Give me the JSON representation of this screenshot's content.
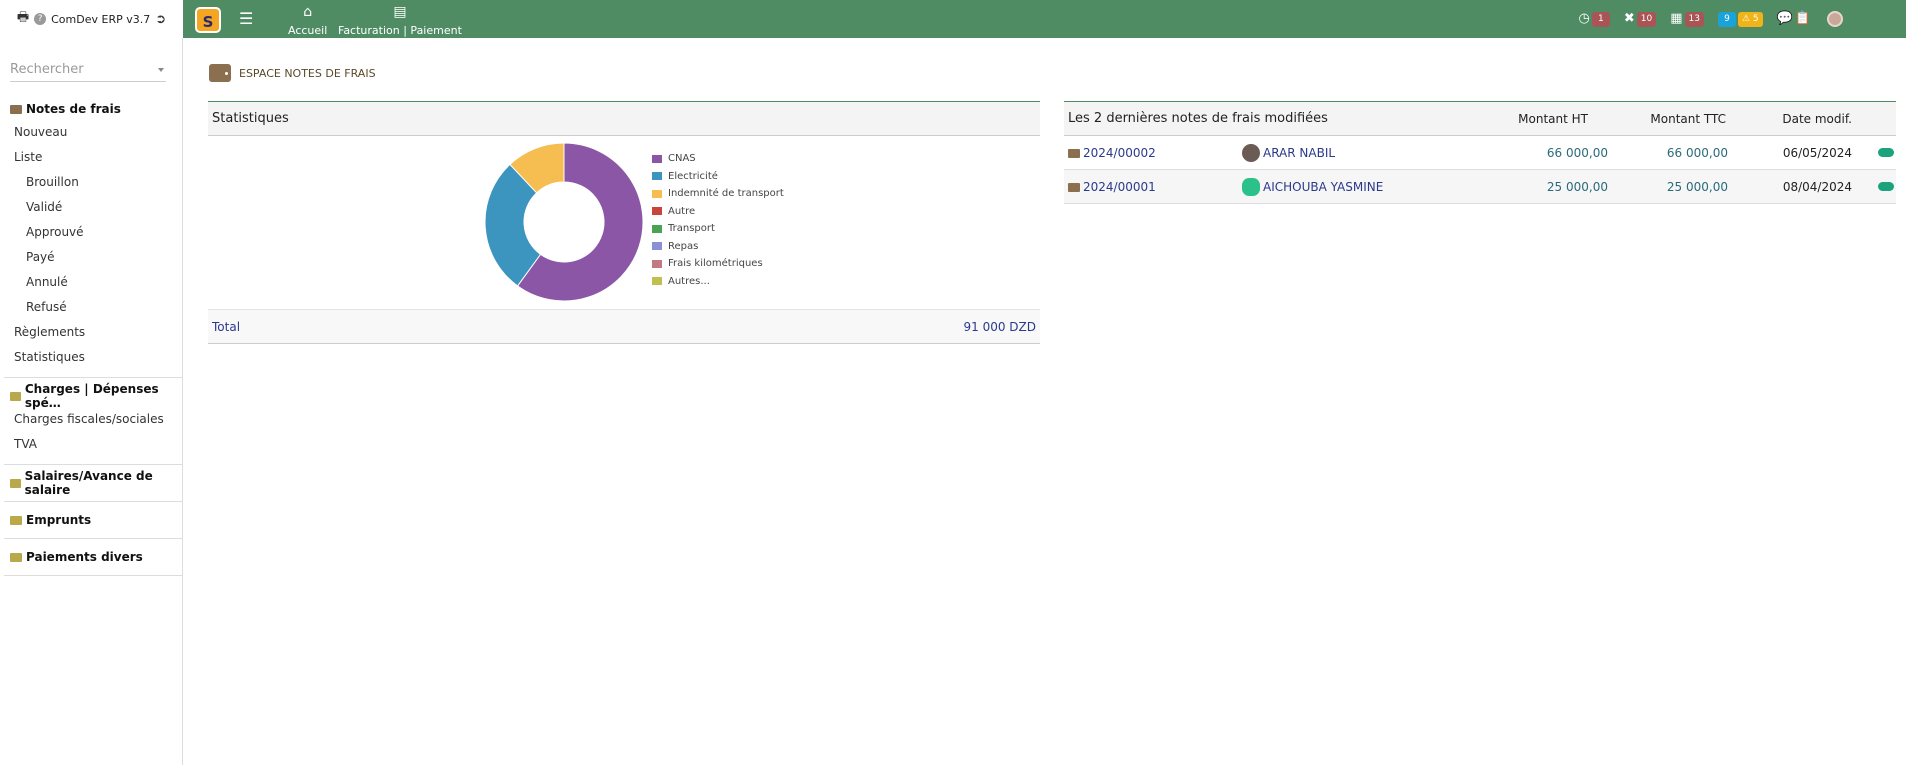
{
  "app": {
    "name": "ComDev ERP v3.7",
    "logo_text": "S"
  },
  "topbar": {
    "nav": [
      {
        "label": "Accueil",
        "icon": "home-icon"
      },
      {
        "label": "Facturation | Paiement",
        "icon": "billing-icon"
      }
    ],
    "badges": {
      "clock": "1",
      "tools": "10",
      "calendar": "13",
      "info": "9",
      "warning": "5"
    }
  },
  "sidebar": {
    "search_placeholder": "Rechercher",
    "sections": {
      "notes": "Notes de frais",
      "charges": "Charges | Dépenses spé…",
      "salaires": "Salaires/Avance de salaire",
      "emprunts": "Emprunts",
      "paiements": "Paiements divers"
    },
    "items": {
      "nouveau": "Nouveau",
      "liste": "Liste",
      "brouillon": "Brouillon",
      "valide": "Validé",
      "approuve": "Approuvé",
      "paye": "Payé",
      "annule": "Annulé",
      "refuse": "Refusé",
      "reglements": "Règlements",
      "statistiques": "Statistiques",
      "charges_fiscales": "Charges fiscales/sociales",
      "tva": "TVA"
    }
  },
  "page": {
    "title": "ESPACE NOTES DE FRAIS"
  },
  "stats": {
    "heading": "Statistiques",
    "total_label": "Total",
    "total_value": "91 000 DZD"
  },
  "chart_data": {
    "type": "pie",
    "categories": [
      "CNAS",
      "Electricité",
      "Indemnité de transport",
      "Autre",
      "Transport",
      "Repas",
      "Frais kilométriques",
      "Autres..."
    ],
    "values": [
      60,
      28,
      12,
      0,
      0,
      0,
      0,
      0
    ],
    "colors": [
      "#8b56a6",
      "#3c95bf",
      "#f6bd50",
      "#c9453a",
      "#4aa355",
      "#8a8fd6",
      "#c17a82",
      "#bfc050"
    ],
    "donut": true,
    "legend": "right"
  },
  "lastnotes": {
    "heading": "Les 2 dernières notes de frais modifiées",
    "col_ht": "Montant HT",
    "col_ttc": "Montant TTC",
    "col_date": "Date modif.",
    "rows": [
      {
        "ref": "2024/00002",
        "user": "ARAR NABIL",
        "ht": "66 000,00",
        "ttc": "66 000,00",
        "date": "06/05/2024"
      },
      {
        "ref": "2024/00001",
        "user": "AICHOUBA YASMINE",
        "ht": "25 000,00",
        "ttc": "25 000,00",
        "date": "08/04/2024"
      }
    ]
  }
}
